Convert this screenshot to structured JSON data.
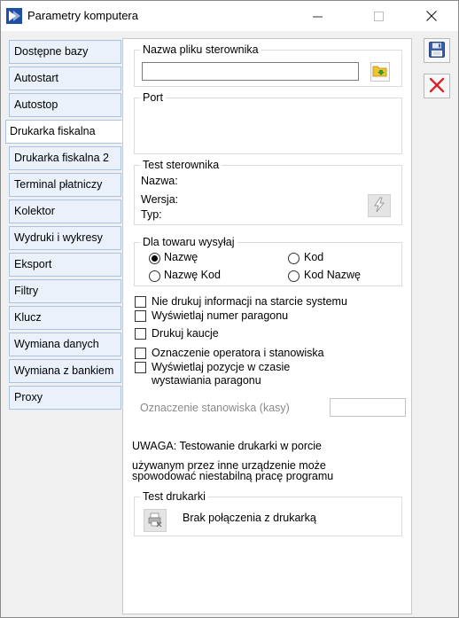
{
  "window": {
    "title": "Parametry komputera"
  },
  "nav": {
    "items": [
      {
        "label": "Dostępne bazy"
      },
      {
        "label": "Autostart"
      },
      {
        "label": "Autostop"
      },
      {
        "label": "Drukarka fiskalna"
      },
      {
        "label": "Drukarka fiskalna 2"
      },
      {
        "label": "Terminal płatniczy"
      },
      {
        "label": "Kolektor"
      },
      {
        "label": "Wydruki i wykresy"
      },
      {
        "label": "Eksport"
      },
      {
        "label": "Filtry"
      },
      {
        "label": "Klucz"
      },
      {
        "label": "Wymiana danych"
      },
      {
        "label": "Wymiana z bankiem"
      },
      {
        "label": "Proxy"
      }
    ],
    "active_index": 3
  },
  "driver": {
    "group_title": "Nazwa pliku sterownika",
    "filename_value": ""
  },
  "port": {
    "group_title": "Port"
  },
  "driver_test": {
    "group_title": "Test sterownika",
    "name_label": "Nazwa:",
    "version_label": "Wersja:",
    "type_label": "Typ:"
  },
  "send_for_item": {
    "group_title": "Dla towaru wysyłaj",
    "options": {
      "name": "Nazwę",
      "code": "Kod",
      "name_code": "Nazwę Kod",
      "code_name": "Kod Nazwę"
    },
    "selected": "name"
  },
  "options": {
    "no_print_startup": "Nie drukuj informacji na starcie systemu",
    "show_receipt_number": "Wyświetlaj numer paragonu",
    "print_deposits": "Drukuj kaucje",
    "operator_station": "Oznaczenie operatora i stanowiska",
    "show_items_line1": "Wyświetlaj pozycje w czasie",
    "show_items_line2": "wystawiania paragonu"
  },
  "station": {
    "label": "Oznaczenie stanowiska (kasy)",
    "value": ""
  },
  "warning": {
    "line1": "UWAGA: Testowanie drukarki w porcie",
    "line2": "używanym przez inne urządzenie może",
    "line3": "spowodować niestabilną pracę programu"
  },
  "printer_test": {
    "group_title": "Test drukarki",
    "status": "Brak połączenia z drukarką"
  },
  "colors": {
    "accent_nav_bg": "#eaf1fb",
    "accent_nav_border": "#a9c3e4",
    "save_icon": "#3a5fa8",
    "cancel_icon": "#d9262a",
    "folder_icon": "#f0b400"
  }
}
